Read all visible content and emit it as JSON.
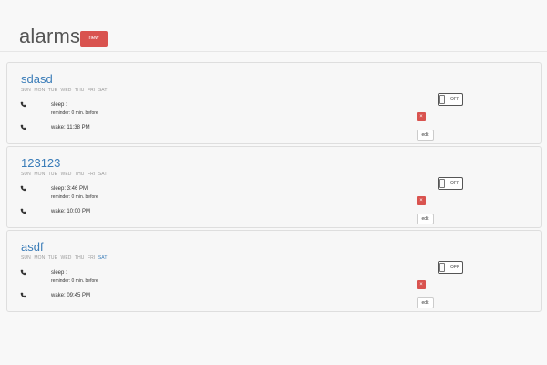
{
  "header": {
    "title": "alarms",
    "new_label": "new"
  },
  "alarms": [
    {
      "name": "sdasd",
      "days": [
        {
          "label": "SUN",
          "active": false
        },
        {
          "label": "MON",
          "active": false
        },
        {
          "label": "TUE",
          "active": false
        },
        {
          "label": "WED",
          "active": false
        },
        {
          "label": "THU",
          "active": false
        },
        {
          "label": "FRI",
          "active": false
        },
        {
          "label": "SAT",
          "active": false
        }
      ],
      "sleep_text": "sleep : ",
      "reminder_text": "reminder: 0 min. before",
      "wake_text": "wake: 11:38 PM",
      "toggle_label": "OFF",
      "delete_label": "×",
      "edit_label": "edit"
    },
    {
      "name": "123123",
      "days": [
        {
          "label": "SUN",
          "active": false
        },
        {
          "label": "MON",
          "active": false
        },
        {
          "label": "TUE",
          "active": false
        },
        {
          "label": "WED",
          "active": false
        },
        {
          "label": "THU",
          "active": false
        },
        {
          "label": "FRI",
          "active": false
        },
        {
          "label": "SAT",
          "active": false
        }
      ],
      "sleep_text": "sleep: 3:46 PM",
      "reminder_text": "reminder: 0 min. before",
      "wake_text": "wake: 10:00 PM",
      "toggle_label": "OFF",
      "delete_label": "×",
      "edit_label": "edit"
    },
    {
      "name": "asdf",
      "days": [
        {
          "label": "SUN",
          "active": false
        },
        {
          "label": "MON",
          "active": false
        },
        {
          "label": "TUE",
          "active": false
        },
        {
          "label": "WED",
          "active": false
        },
        {
          "label": "THU",
          "active": false
        },
        {
          "label": "FRI",
          "active": false
        },
        {
          "label": "SAT",
          "active": true
        }
      ],
      "sleep_text": "sleep : ",
      "reminder_text": "reminder: 0 min. before",
      "wake_text": "wake: 09:45 PM",
      "toggle_label": "OFF",
      "delete_label": "×",
      "edit_label": "edit"
    }
  ],
  "colors": {
    "accent": "#3a7cb8",
    "danger": "#d9534f",
    "background": "#f8f8f8"
  },
  "icons": {
    "line_icon": "phone-icon"
  }
}
